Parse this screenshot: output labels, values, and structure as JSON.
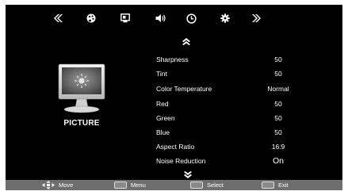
{
  "top_tabs": [
    {
      "name": "prev-page",
      "icon": "double-chevron-left-icon"
    },
    {
      "name": "color",
      "icon": "palette-icon"
    },
    {
      "name": "picture",
      "icon": "monitor-icon"
    },
    {
      "name": "sound",
      "icon": "speaker-icon"
    },
    {
      "name": "time",
      "icon": "clock-icon"
    },
    {
      "name": "setup",
      "icon": "gear-icon"
    },
    {
      "name": "next-page",
      "icon": "double-chevron-right-icon"
    }
  ],
  "category": {
    "label": "PICTURE",
    "icon": "tv-monitor-icon"
  },
  "settings": [
    {
      "label": "Sharpness",
      "value": "50"
    },
    {
      "label": "Tint",
      "value": "50"
    },
    {
      "label": "Color  Temperature",
      "value": "Normal"
    },
    {
      "label": "Red",
      "value": "50"
    },
    {
      "label": "Green",
      "value": "50"
    },
    {
      "label": "Blue",
      "value": "50"
    },
    {
      "label": "Aspect  Ratio",
      "value": "16:9"
    },
    {
      "label": "Noise Reduction",
      "value": "On"
    }
  ],
  "footer": {
    "move": "Move",
    "menu": "Menu",
    "select": "Select",
    "exit": "Exit"
  },
  "colors": {
    "background": "#000000",
    "text": "#ffffff",
    "footer_bar": "#6e6e6e"
  }
}
